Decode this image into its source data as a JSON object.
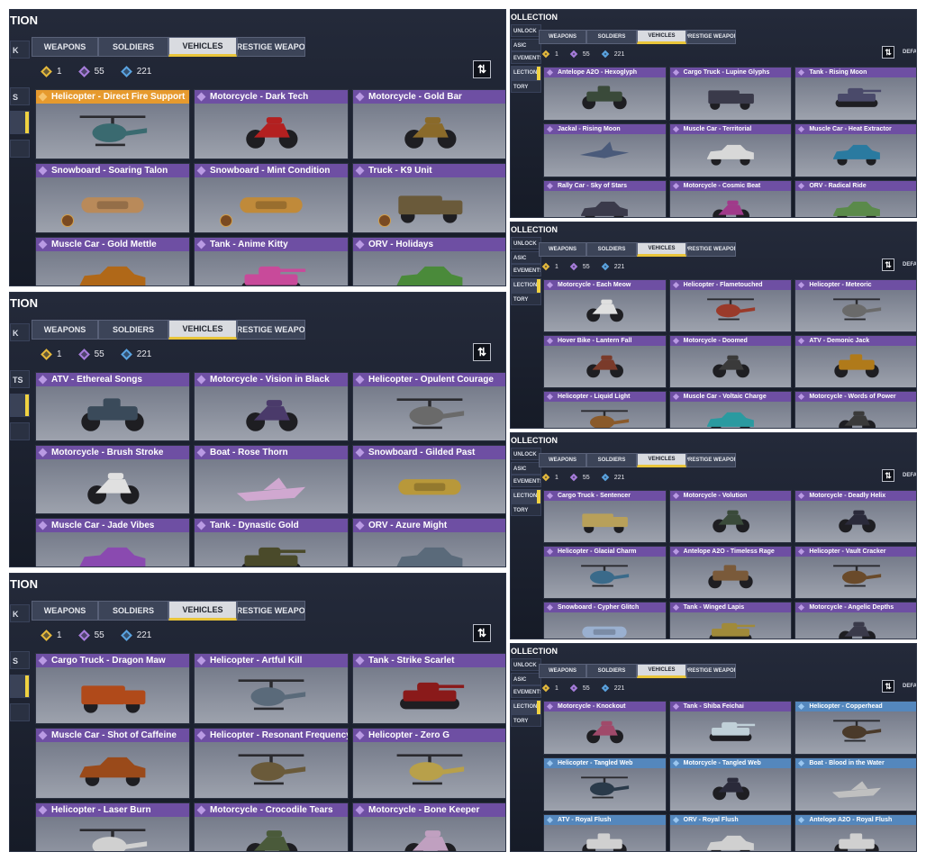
{
  "tabs": [
    "WEAPONS",
    "SOLDIERS",
    "VEHICLES",
    "PRESTIGE WEAPON"
  ],
  "active_tab": "VEHICLES",
  "currency": [
    {
      "value": "1",
      "color": "#e5b93c"
    },
    {
      "value": "55",
      "color": "#a77ddb"
    },
    {
      "value": "221",
      "color": "#5aa3e0"
    }
  ],
  "colors": {
    "purple": "#6e4fa3",
    "orange": "#e69a2e",
    "blue": "#5487bd",
    "accent": "#f0d241"
  },
  "icons": {
    "sort": "sort-arrows-icon",
    "rarity": "diamond-icon",
    "currency": "diamond-icon"
  },
  "panels": [
    {
      "title": "TION",
      "side": [
        "K",
        "S",
        "",
        ""
      ],
      "cards": [
        {
          "name": "Helicopter - Direct Fire Support",
          "rarity": "orange",
          "car": "#3a6a70",
          "shape": "heli",
          "badge": false
        },
        {
          "name": "Motorcycle - Dark Tech",
          "rarity": "purple",
          "car": "#b32020",
          "shape": "moto",
          "badge": false
        },
        {
          "name": "Motorcycle - Gold Bar",
          "rarity": "purple",
          "car": "#8a6a2a",
          "shape": "moto",
          "badge": false
        },
        {
          "name": "Snowboard - Soaring Talon",
          "rarity": "purple",
          "car": "#b98a5a",
          "shape": "board",
          "badge": true
        },
        {
          "name": "Snowboard - Mint Condition",
          "rarity": "purple",
          "car": "#c08a3a",
          "shape": "board",
          "badge": true
        },
        {
          "name": "Truck - K9 Unit",
          "rarity": "purple",
          "car": "#6a5a3a",
          "shape": "truck",
          "badge": true
        },
        {
          "name": "Muscle Car - Gold Mettle",
          "rarity": "purple",
          "car": "#b06818",
          "shape": "car",
          "badge": false
        },
        {
          "name": "Tank - Anime Kitty",
          "rarity": "purple",
          "car": "#c84a9a",
          "shape": "tank",
          "badge": false
        },
        {
          "name": "ORV - Holidays",
          "rarity": "purple",
          "car": "#4a8a3a",
          "shape": "car",
          "badge": false
        }
      ]
    },
    {
      "title": "TION",
      "side": [
        "K",
        "TS",
        "",
        ""
      ],
      "cards": [
        {
          "name": "ATV - Ethereal Songs",
          "rarity": "purple",
          "car": "#3a4a5a",
          "shape": "atv",
          "badge": false
        },
        {
          "name": "Motorcycle - Vision in Black",
          "rarity": "purple",
          "car": "#4a3a6a",
          "shape": "moto",
          "badge": false
        },
        {
          "name": "Helicopter - Opulent Courage",
          "rarity": "purple",
          "car": "#6a6a6a",
          "shape": "heli",
          "badge": false
        },
        {
          "name": "Motorcycle - Brush Stroke",
          "rarity": "purple",
          "car": "#e0e0e0",
          "shape": "moto",
          "badge": false
        },
        {
          "name": "Boat - Rose Thorn",
          "rarity": "purple",
          "car": "#d0a8d0",
          "shape": "boat",
          "badge": false
        },
        {
          "name": "Snowboard - Gilded Past",
          "rarity": "purple",
          "car": "#b8983a",
          "shape": "board",
          "badge": false
        },
        {
          "name": "Muscle Car - Jade Vibes",
          "rarity": "purple",
          "car": "#8a4ab0",
          "shape": "car",
          "badge": false
        },
        {
          "name": "Tank - Dynastic Gold",
          "rarity": "purple",
          "car": "#4a4a2a",
          "shape": "tank",
          "badge": false
        },
        {
          "name": "ORV - Azure Might",
          "rarity": "purple",
          "car": "#5a6a7a",
          "shape": "car",
          "badge": false
        }
      ]
    },
    {
      "title": "TION",
      "side": [
        "K",
        "S",
        "",
        ""
      ],
      "cards": [
        {
          "name": "Cargo Truck - Dragon Maw",
          "rarity": "purple",
          "car": "#b04a1a",
          "shape": "truck",
          "badge": false
        },
        {
          "name": "Helicopter - Artful Kill",
          "rarity": "purple",
          "car": "#5a6a7a",
          "shape": "heli",
          "badge": false
        },
        {
          "name": "Tank - Strike Scarlet",
          "rarity": "purple",
          "car": "#8a1a1a",
          "shape": "tank",
          "badge": false
        },
        {
          "name": "Muscle Car - Shot of Caffeine",
          "rarity": "purple",
          "car": "#9a4a1a",
          "shape": "car",
          "badge": false
        },
        {
          "name": "Helicopter - Resonant Frequency",
          "rarity": "purple",
          "car": "#6a5a3a",
          "shape": "heli",
          "badge": false
        },
        {
          "name": "Helicopter - Zero G",
          "rarity": "purple",
          "car": "#b8a04a",
          "shape": "heli",
          "badge": false
        },
        {
          "name": "Helicopter - Laser Burn",
          "rarity": "purple",
          "car": "#d0d0d0",
          "shape": "heli",
          "badge": false
        },
        {
          "name": "Motorcycle - Crocodile Tears",
          "rarity": "purple",
          "car": "#4a5a3a",
          "shape": "moto",
          "badge": false
        },
        {
          "name": "Motorcycle - Bone Keeper",
          "rarity": "purple",
          "car": "#c0a0c0",
          "shape": "moto",
          "badge": false
        }
      ]
    },
    {
      "title": "OLLECTION",
      "side": [
        "UNLOCK",
        "ASIC",
        "EVEMENTS",
        "LECTION",
        "TORY"
      ],
      "default_label": "DEFAU",
      "cards": [
        {
          "name": "Antelope A2O - Hexoglyph",
          "rarity": "purple",
          "car": "#3a4a3a",
          "shape": "atv",
          "badge": false
        },
        {
          "name": "Cargo Truck - Lupine Glyphs",
          "rarity": "purple",
          "car": "#3a3a4a",
          "shape": "truck",
          "badge": false
        },
        {
          "name": "Tank - Rising Moon",
          "rarity": "purple",
          "car": "#4a4a6a",
          "shape": "tank",
          "badge": false
        },
        {
          "name": "Jackal - Rising Moon",
          "rarity": "purple",
          "car": "#4a5a7a",
          "shape": "jet",
          "badge": false
        },
        {
          "name": "Muscle Car - Territorial",
          "rarity": "purple",
          "car": "#d8d8d8",
          "shape": "car",
          "badge": false
        },
        {
          "name": "Muscle Car - Heat Extractor",
          "rarity": "purple",
          "car": "#2a7aa0",
          "shape": "car",
          "badge": false
        },
        {
          "name": "Rally Car - Sky of Stars",
          "rarity": "purple",
          "car": "#3a3a4a",
          "shape": "car",
          "badge": false
        },
        {
          "name": "Motorcycle - Cosmic Beat",
          "rarity": "purple",
          "car": "#a03a8a",
          "shape": "moto",
          "badge": false
        },
        {
          "name": "ORV - Radical Ride",
          "rarity": "purple",
          "car": "#5a8a4a",
          "shape": "car",
          "badge": false
        }
      ]
    },
    {
      "title": "OLLECTION",
      "side": [
        "UNLOCK",
        "ASIC",
        "EVEMENTS",
        "LECTION",
        "TORY"
      ],
      "default_label": "DEFAU",
      "cards": [
        {
          "name": "Motorcycle - Each Meow",
          "rarity": "purple",
          "car": "#e0e0e0",
          "shape": "moto",
          "badge": false
        },
        {
          "name": "Helicopter - Flametouched",
          "rarity": "purple",
          "car": "#9a3a2a",
          "shape": "heli",
          "badge": false
        },
        {
          "name": "Helicopter - Meteoric",
          "rarity": "purple",
          "car": "#6a6a6a",
          "shape": "heli",
          "badge": false
        },
        {
          "name": "Hover Bike - Lantern Fall",
          "rarity": "purple",
          "car": "#7a3a2a",
          "shape": "moto",
          "badge": false
        },
        {
          "name": "Motorcycle - Doomed",
          "rarity": "purple",
          "car": "#3a3a3a",
          "shape": "moto",
          "badge": false
        },
        {
          "name": "ATV - Demonic Jack",
          "rarity": "purple",
          "car": "#b07a1a",
          "shape": "atv",
          "badge": false
        },
        {
          "name": "Helicopter - Liquid Light",
          "rarity": "purple",
          "car": "#8a5a2a",
          "shape": "heli",
          "badge": false
        },
        {
          "name": "Muscle Car - Voltaic Charge",
          "rarity": "purple",
          "car": "#2a9aa0",
          "shape": "car",
          "badge": false
        },
        {
          "name": "Motorcycle - Words of Power",
          "rarity": "purple",
          "car": "#3a3a3a",
          "shape": "moto",
          "badge": false
        }
      ]
    },
    {
      "title": "OLLECTION",
      "side": [
        "UNLOCK",
        "ASIC",
        "EVEMENTS",
        "LECTION",
        "TORY"
      ],
      "default_label": "DEFAU",
      "cards": [
        {
          "name": "Cargo Truck - Sentencer",
          "rarity": "purple",
          "car": "#b8a05a",
          "shape": "truck",
          "badge": false
        },
        {
          "name": "Motorcycle - Volution",
          "rarity": "purple",
          "car": "#3a4a3a",
          "shape": "moto",
          "badge": false
        },
        {
          "name": "Motorcycle - Deadly Helix",
          "rarity": "purple",
          "car": "#2a2a3a",
          "shape": "moto",
          "badge": false
        },
        {
          "name": "Helicopter - Glacial Charm",
          "rarity": "purple",
          "car": "#3a6a8a",
          "shape": "heli",
          "badge": false
        },
        {
          "name": "Antelope A2O - Timeless Rage",
          "rarity": "purple",
          "car": "#7a5a3a",
          "shape": "atv",
          "badge": false
        },
        {
          "name": "Helicopter - Vault Cracker",
          "rarity": "purple",
          "car": "#6a4a2a",
          "shape": "heli",
          "badge": false
        },
        {
          "name": "Snowboard - Cypher Glitch",
          "rarity": "purple",
          "car": "#9ab0d0",
          "shape": "board",
          "badge": false
        },
        {
          "name": "Tank - Winged Lapis",
          "rarity": "purple",
          "car": "#a08a3a",
          "shape": "tank",
          "badge": false
        },
        {
          "name": "Motorcycle - Angelic Depths",
          "rarity": "purple",
          "car": "#3a3a4a",
          "shape": "moto",
          "badge": false
        }
      ]
    },
    {
      "title": "OLLECTION",
      "side": [
        "UNLOCK",
        "ASIC",
        "EVEMENTS",
        "LECTION",
        "TORY"
      ],
      "default_label": "DEFAU",
      "cards": [
        {
          "name": "Motorcycle - Knockout",
          "rarity": "purple",
          "car": "#a04a6a",
          "shape": "moto",
          "badge": false
        },
        {
          "name": "Tank - Shiba Feichai",
          "rarity": "purple",
          "car": "#c0d0d8",
          "shape": "tank",
          "badge": false
        },
        {
          "name": "Helicopter - Copperhead",
          "rarity": "blue",
          "car": "#4a3a2a",
          "shape": "heli",
          "badge": false
        },
        {
          "name": "Helicopter - Tangled Web",
          "rarity": "blue",
          "car": "#2a3a4a",
          "shape": "heli",
          "badge": false
        },
        {
          "name": "Motorcycle - Tangled Web",
          "rarity": "blue",
          "car": "#2a2a3a",
          "shape": "moto",
          "badge": false
        },
        {
          "name": "Boat - Blood in the Water",
          "rarity": "blue",
          "car": "#c0c0c0",
          "shape": "boat",
          "badge": false
        },
        {
          "name": "ATV - Royal Flush",
          "rarity": "blue",
          "car": "#d0d0d0",
          "shape": "atv",
          "badge": false
        },
        {
          "name": "ORV - Royal Flush",
          "rarity": "blue",
          "car": "#d0d0d0",
          "shape": "car",
          "badge": false
        },
        {
          "name": "Antelope A2O - Royal Flush",
          "rarity": "blue",
          "car": "#d0d0d0",
          "shape": "atv",
          "badge": false
        }
      ]
    }
  ]
}
